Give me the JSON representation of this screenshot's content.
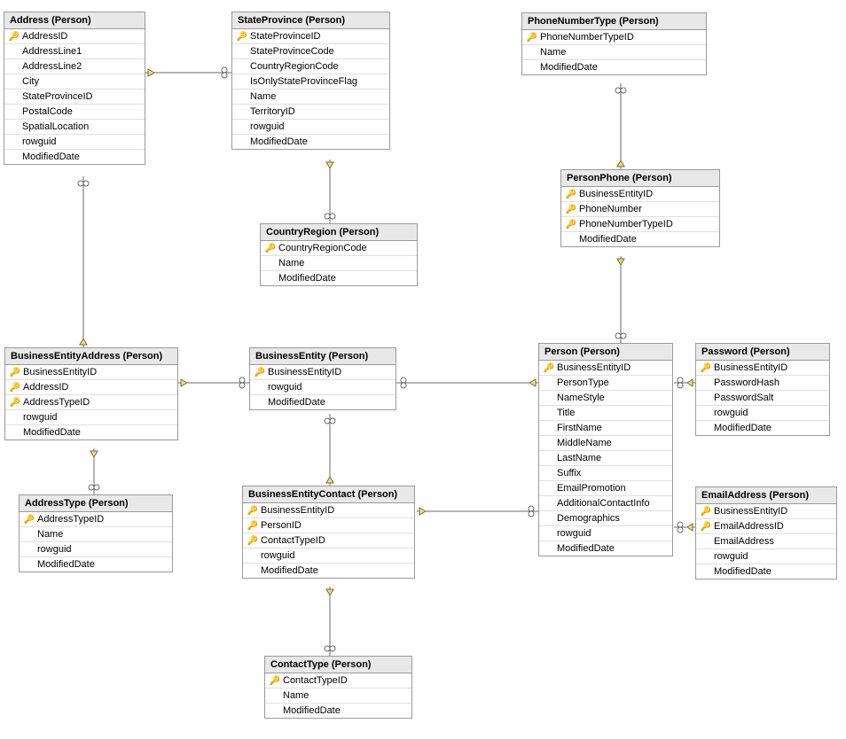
{
  "entities": {
    "address": {
      "title": "Address (Person)",
      "columns": [
        {
          "key": true,
          "name": "AddressID"
        },
        {
          "key": false,
          "name": "AddressLine1"
        },
        {
          "key": false,
          "name": "AddressLine2"
        },
        {
          "key": false,
          "name": "City"
        },
        {
          "key": false,
          "name": "StateProvinceID"
        },
        {
          "key": false,
          "name": "PostalCode"
        },
        {
          "key": false,
          "name": "SpatialLocation"
        },
        {
          "key": false,
          "name": "rowguid"
        },
        {
          "key": false,
          "name": "ModifiedDate"
        }
      ]
    },
    "stateProvince": {
      "title": "StateProvince (Person)",
      "columns": [
        {
          "key": true,
          "name": "StateProvinceID"
        },
        {
          "key": false,
          "name": "StateProvinceCode"
        },
        {
          "key": false,
          "name": "CountryRegionCode"
        },
        {
          "key": false,
          "name": "IsOnlyStateProvinceFlag"
        },
        {
          "key": false,
          "name": "Name"
        },
        {
          "key": false,
          "name": "TerritoryID"
        },
        {
          "key": false,
          "name": "rowguid"
        },
        {
          "key": false,
          "name": "ModifiedDate"
        }
      ]
    },
    "phoneNumberType": {
      "title": "PhoneNumberType (Person)",
      "columns": [
        {
          "key": true,
          "name": "PhoneNumberTypeID"
        },
        {
          "key": false,
          "name": "Name"
        },
        {
          "key": false,
          "name": "ModifiedDate"
        }
      ]
    },
    "personPhone": {
      "title": "PersonPhone (Person)",
      "columns": [
        {
          "key": true,
          "name": "BusinessEntityID"
        },
        {
          "key": true,
          "name": "PhoneNumber"
        },
        {
          "key": true,
          "name": "PhoneNumberTypeID"
        },
        {
          "key": false,
          "name": "ModifiedDate"
        }
      ]
    },
    "countryRegion": {
      "title": "CountryRegion (Person)",
      "columns": [
        {
          "key": true,
          "name": "CountryRegionCode"
        },
        {
          "key": false,
          "name": "Name"
        },
        {
          "key": false,
          "name": "ModifiedDate"
        }
      ]
    },
    "businessEntityAddress": {
      "title": "BusinessEntityAddress (Person)",
      "columns": [
        {
          "key": true,
          "name": "BusinessEntityID"
        },
        {
          "key": true,
          "name": "AddressID"
        },
        {
          "key": true,
          "name": "AddressTypeID"
        },
        {
          "key": false,
          "name": "rowguid"
        },
        {
          "key": false,
          "name": "ModifiedDate"
        }
      ]
    },
    "businessEntity": {
      "title": "BusinessEntity (Person)",
      "columns": [
        {
          "key": true,
          "name": "BusinessEntityID"
        },
        {
          "key": false,
          "name": "rowguid"
        },
        {
          "key": false,
          "name": "ModifiedDate"
        }
      ]
    },
    "person": {
      "title": "Person (Person)",
      "columns": [
        {
          "key": true,
          "name": "BusinessEntityID"
        },
        {
          "key": false,
          "name": "PersonType"
        },
        {
          "key": false,
          "name": "NameStyle"
        },
        {
          "key": false,
          "name": "Title"
        },
        {
          "key": false,
          "name": "FirstName"
        },
        {
          "key": false,
          "name": "MiddleName"
        },
        {
          "key": false,
          "name": "LastName"
        },
        {
          "key": false,
          "name": "Suffix"
        },
        {
          "key": false,
          "name": "EmailPromotion"
        },
        {
          "key": false,
          "name": "AdditionalContactInfo"
        },
        {
          "key": false,
          "name": "Demographics"
        },
        {
          "key": false,
          "name": "rowguid"
        },
        {
          "key": false,
          "name": "ModifiedDate"
        }
      ]
    },
    "password": {
      "title": "Password (Person)",
      "columns": [
        {
          "key": true,
          "name": "BusinessEntityID"
        },
        {
          "key": false,
          "name": "PasswordHash"
        },
        {
          "key": false,
          "name": "PasswordSalt"
        },
        {
          "key": false,
          "name": "rowguid"
        },
        {
          "key": false,
          "name": "ModifiedDate"
        }
      ]
    },
    "emailAddress": {
      "title": "EmailAddress (Person)",
      "columns": [
        {
          "key": true,
          "name": "BusinessEntityID"
        },
        {
          "key": true,
          "name": "EmailAddressID"
        },
        {
          "key": false,
          "name": "EmailAddress"
        },
        {
          "key": false,
          "name": "rowguid"
        },
        {
          "key": false,
          "name": "ModifiedDate"
        }
      ]
    },
    "addressType": {
      "title": "AddressType (Person)",
      "columns": [
        {
          "key": true,
          "name": "AddressTypeID"
        },
        {
          "key": false,
          "name": "Name"
        },
        {
          "key": false,
          "name": "rowguid"
        },
        {
          "key": false,
          "name": "ModifiedDate"
        }
      ]
    },
    "businessEntityContact": {
      "title": "BusinessEntityContact (Person)",
      "columns": [
        {
          "key": true,
          "name": "BusinessEntityID"
        },
        {
          "key": true,
          "name": "PersonID"
        },
        {
          "key": true,
          "name": "ContactTypeID"
        },
        {
          "key": false,
          "name": "rowguid"
        },
        {
          "key": false,
          "name": "ModifiedDate"
        }
      ]
    },
    "contactType": {
      "title": "ContactType (Person)",
      "columns": [
        {
          "key": true,
          "name": "ContactTypeID"
        },
        {
          "key": false,
          "name": "Name"
        },
        {
          "key": false,
          "name": "ModifiedDate"
        }
      ]
    }
  }
}
